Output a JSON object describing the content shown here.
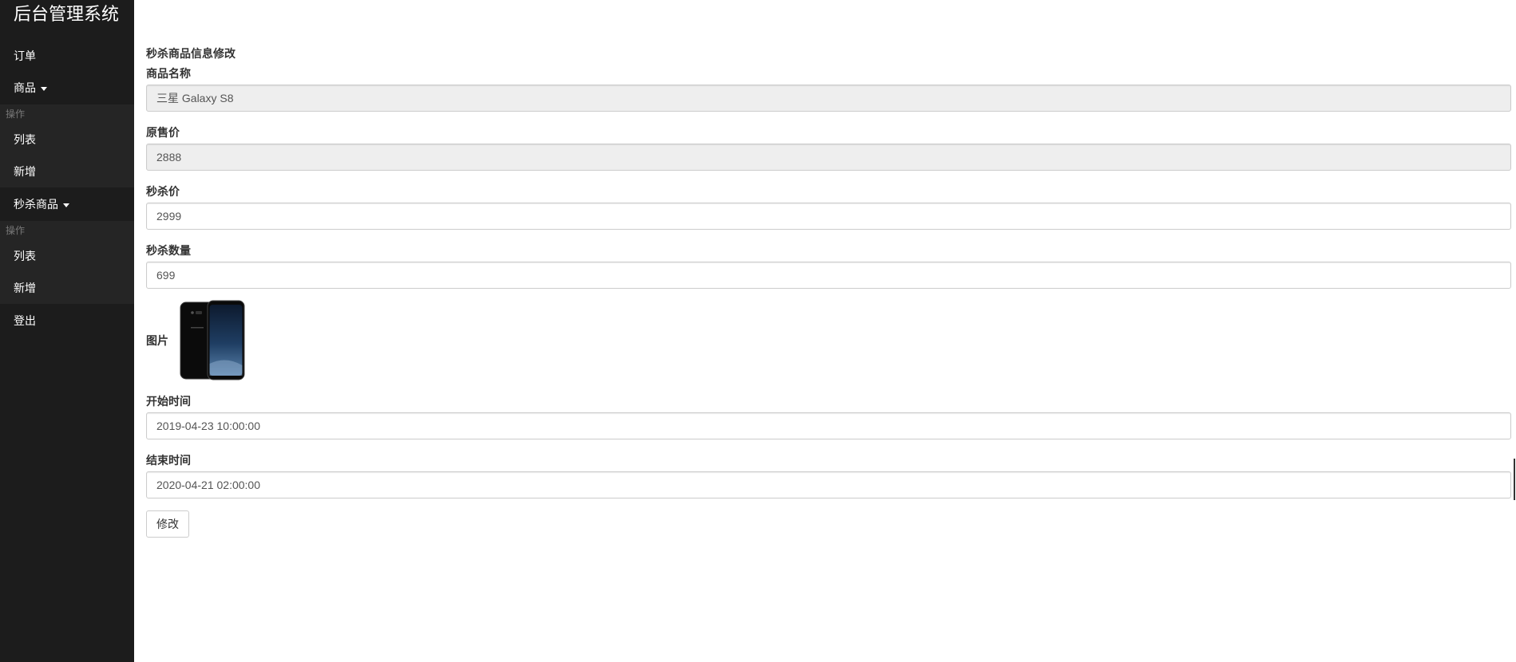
{
  "app": {
    "title": "后台管理系统"
  },
  "sidebar": {
    "items": [
      {
        "label": "订单"
      },
      {
        "label": "商品"
      },
      {
        "label": "操作"
      },
      {
        "label": "列表"
      },
      {
        "label": "新增"
      },
      {
        "label": "秒杀商品"
      },
      {
        "label": "操作"
      },
      {
        "label": "列表"
      },
      {
        "label": "新增"
      },
      {
        "label": "登出"
      }
    ]
  },
  "form": {
    "title": "秒杀商品信息修改",
    "fields": {
      "goods_name": {
        "label": "商品名称",
        "value": "三星 Galaxy S8"
      },
      "original_price": {
        "label": "原售价",
        "value": "2888"
      },
      "seckill_price": {
        "label": "秒杀价",
        "value": "2999"
      },
      "seckill_quantity": {
        "label": "秒杀数量",
        "value": "699"
      },
      "image": {
        "label": "图片"
      },
      "start_time": {
        "label": "开始时间",
        "value": "2019-04-23 10:00:00"
      },
      "end_time": {
        "label": "结束时间",
        "value": "2020-04-21 02:00:00"
      }
    },
    "submit_label": "修改"
  },
  "icons": {
    "caret": "caret-down-icon",
    "product_image": "phone-image"
  }
}
